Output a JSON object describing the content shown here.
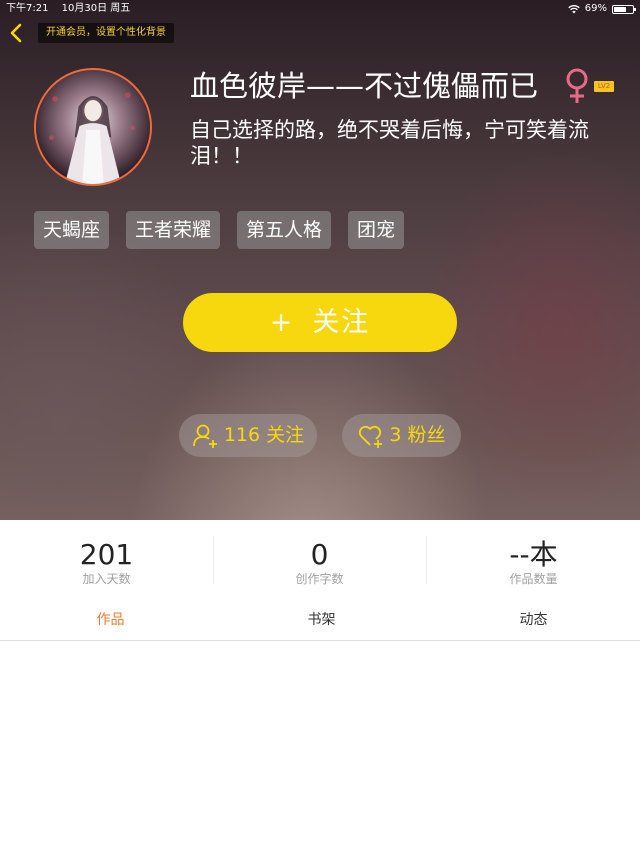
{
  "status_bar": {
    "time": "下午7:21",
    "date": "10月30日 周五",
    "battery": "69%",
    "battery_level": 0.69,
    "icons": [
      "wifi-icon",
      "battery-icon"
    ]
  },
  "header": {
    "back_icon": "chevron-left-icon",
    "vip_banner": "开通会员，设置个性化背景"
  },
  "profile": {
    "username": "血色彼岸——不过傀儡而已",
    "gender_symbol": "♀",
    "gender_color": "#e86a8a",
    "level": "LV2",
    "bio": "自己选择的路，绝不哭着后悔，宁可笑着流泪！！",
    "tags": [
      "天蝎座",
      "王者荣耀",
      "第五人格",
      "团宠"
    ]
  },
  "actions": {
    "follow_plus": "+",
    "follow_label": "关注",
    "following_label": "116 关注",
    "fans_label": "3 粉丝"
  },
  "stats": [
    {
      "value": "201",
      "label": "加入天数"
    },
    {
      "value": "0",
      "label": "创作字数"
    },
    {
      "value": "--本",
      "label": "作品数量"
    }
  ],
  "tabs": [
    {
      "label": "作品",
      "active": true
    },
    {
      "label": "书架",
      "active": false
    },
    {
      "label": "动态",
      "active": false
    }
  ],
  "colors": {
    "accent_yellow": "#f7d70e",
    "active_tab": "#f07a2e",
    "avatar_ring": "#f26a3a"
  }
}
